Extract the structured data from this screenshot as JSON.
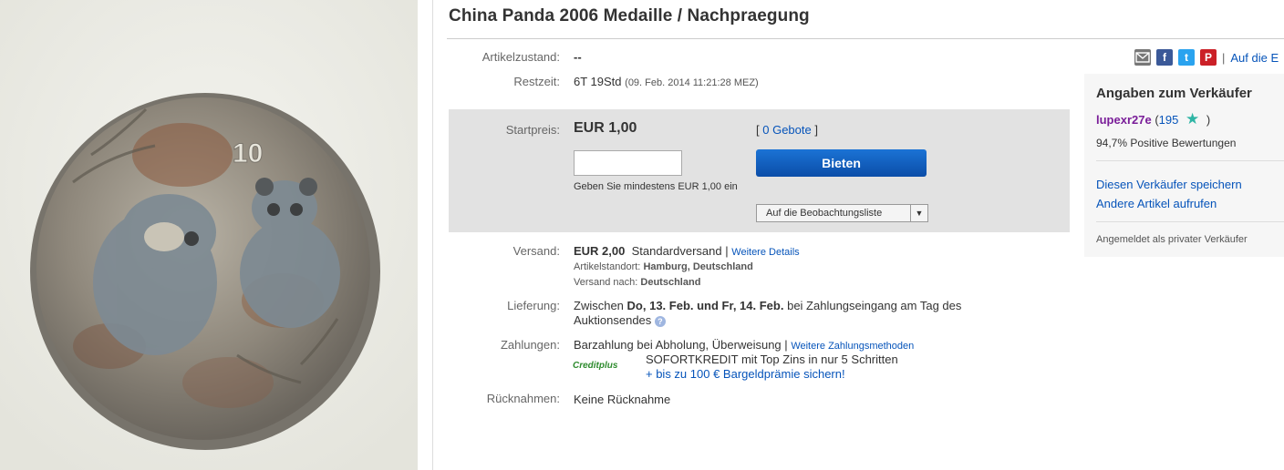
{
  "listing": {
    "title": "China Panda 2006 Medaille / Nachpraegung",
    "condition_label": "Artikelzustand:",
    "condition_value": "--",
    "time_label": "Restzeit:",
    "time_value": "6T 19Std",
    "time_end": "(09. Feb. 2014  11:21:28 MEZ)"
  },
  "coin": {
    "denomination": "10"
  },
  "share": {
    "icons": [
      "email-icon",
      "facebook-icon",
      "twitter-icon",
      "pinterest-icon"
    ],
    "separator": "|",
    "watch_link": "Auf die E"
  },
  "bid": {
    "start_label": "Startpreis:",
    "start_price": "EUR 1,00",
    "bids_open": "[",
    "bids_link": "0 Gebote",
    "bids_close": "]",
    "input_value": "",
    "button": "Bieten",
    "hint": "Geben Sie mindestens EUR 1,00 ein",
    "watchlist": "Auf die Beobachtungsliste"
  },
  "shipping": {
    "label": "Versand:",
    "price": "EUR 2,00",
    "method": "Standardversand",
    "sep": "|",
    "details_link": "Weitere Details",
    "location_label": "Artikelstandort:",
    "location_value": "Hamburg, Deutschland",
    "to_label": "Versand nach:",
    "to_value": "Deutschland"
  },
  "delivery": {
    "label": "Lieferung:",
    "prefix": "Zwischen",
    "dates": "Do, 13. Feb. und Fr, 14. Feb.",
    "suffix": "bei Zahlungseingang am Tag des",
    "line2": "Auktionsendes"
  },
  "payment": {
    "label": "Zahlungen:",
    "methods": "Barzahlung bei Abholung,  Überweisung",
    "sep": "|",
    "more_link": "Weitere Zahlungsmethoden",
    "creditplus_logo": "Creditplus",
    "credit_line1": "SOFORTKREDIT mit Top Zins in nur 5 Schritten",
    "credit_line2": "+ bis zu 100 € Bargeldprämie sichern!"
  },
  "returns": {
    "label": "Rücknahmen:",
    "value": "Keine Rücknahme"
  },
  "seller": {
    "heading": "Angaben zum Verkäufer",
    "name": "lupexr27e",
    "score_open": "(",
    "score": "195",
    "score_close": ")",
    "positive": "94,7% Positive Bewertungen",
    "save_link": "Diesen Verkäufer speichern",
    "other_link": "Andere Artikel aufrufen",
    "type": "Angemeldet als privater Verkäufer"
  },
  "colors": {
    "link": "#0654ba",
    "button": "#0b5cc1",
    "seller_name": "#7a1e99",
    "star": "#2fb5a5"
  }
}
